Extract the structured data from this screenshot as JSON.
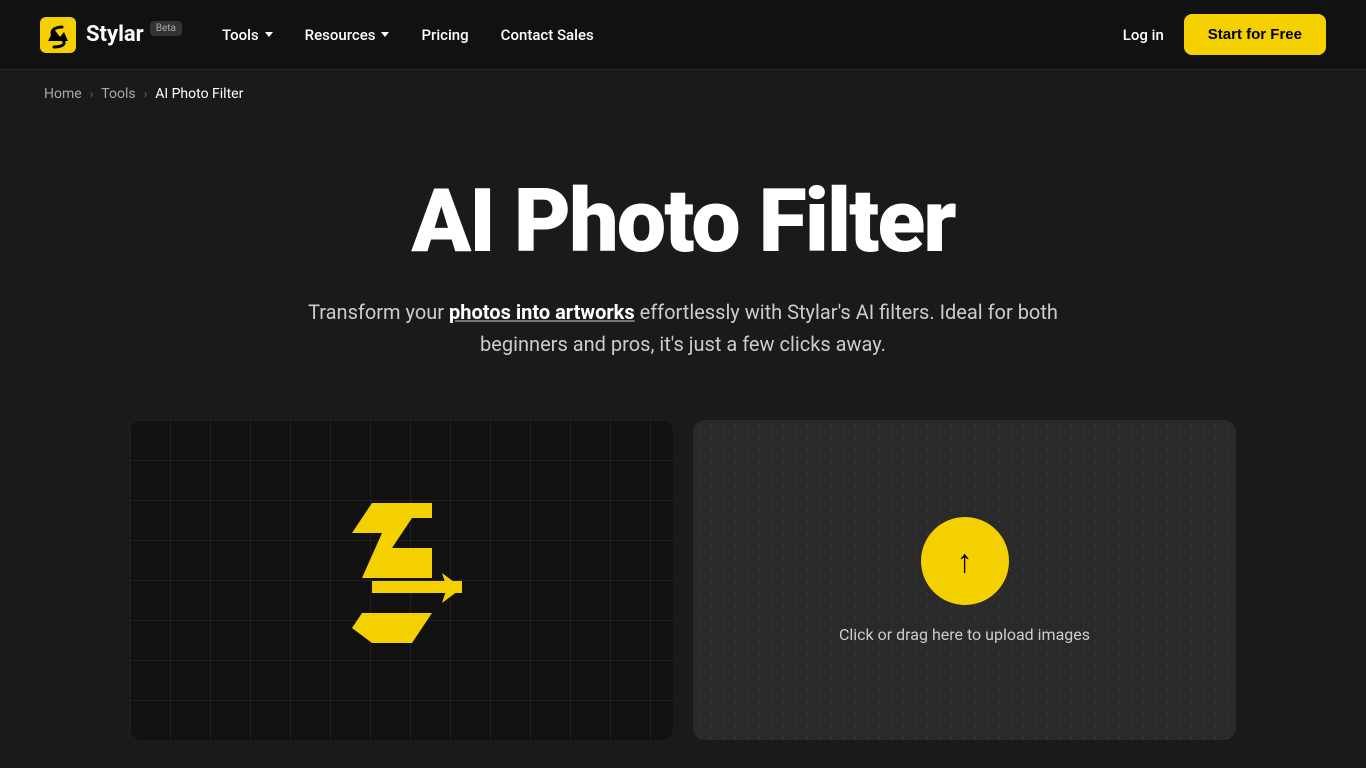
{
  "brand": {
    "name": "Stylar",
    "beta_label": "Beta",
    "logo_alt": "Stylar Logo"
  },
  "navbar": {
    "links": [
      {
        "label": "Tools",
        "has_dropdown": true
      },
      {
        "label": "Resources",
        "has_dropdown": true
      },
      {
        "label": "Pricing",
        "has_dropdown": false
      },
      {
        "label": "Contact Sales",
        "has_dropdown": false
      }
    ],
    "login_label": "Log in",
    "cta_label": "Start for Free"
  },
  "breadcrumb": {
    "items": [
      {
        "label": "Home",
        "active": false
      },
      {
        "label": "Tools",
        "active": false
      },
      {
        "label": "AI Photo Filter",
        "active": true
      }
    ]
  },
  "hero": {
    "title": "AI Photo Filter",
    "subtitle_before": "Transform your ",
    "subtitle_highlight": "photos into artworks",
    "subtitle_after": " effortlessly with Stylar's AI filters. Ideal for both beginners and pros, it's just a few clicks away."
  },
  "upload": {
    "prompt": "Click or drag here to upload images"
  },
  "colors": {
    "accent": "#f5d000",
    "background": "#1a1a1a",
    "navbar_bg": "#111111"
  }
}
